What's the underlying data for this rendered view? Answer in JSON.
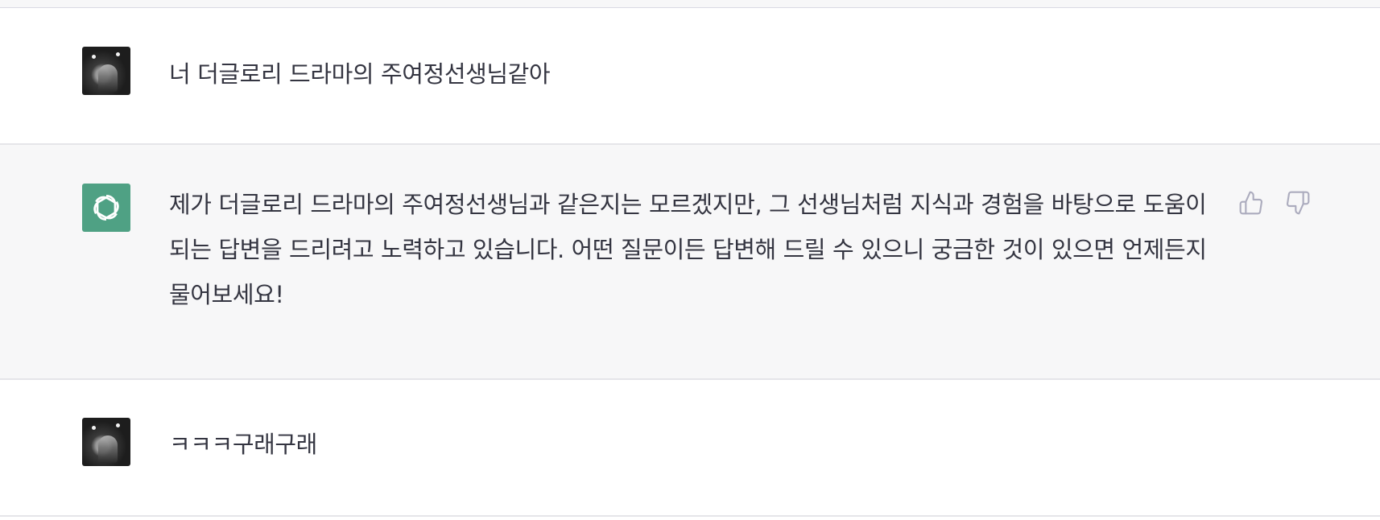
{
  "conversation": {
    "messages": [
      {
        "role": "user",
        "avatar": "user-photo-avatar",
        "text": "너 더글로리 드라마의 주여정선생님같아"
      },
      {
        "role": "assistant",
        "avatar": "openai-logo-icon",
        "text": "제가 더글로리 드라마의 주여정선생님과 같은지는 모르겠지만, 그 선생님처럼 지식과 경험을 바탕으로 도움이 되는 답변을 드리려고 노력하고 있습니다. 어떤 질문이든 답변해 드릴 수 있으니 궁금한 것이 있으면 언제든지 물어보세요!",
        "feedback": {
          "thumbs_up_icon": "thumbs-up-icon",
          "thumbs_down_icon": "thumbs-down-icon"
        }
      },
      {
        "role": "user",
        "avatar": "user-photo-avatar",
        "text": "ㅋㅋㅋ구래구래"
      }
    ]
  },
  "colors": {
    "assistant_bg": "#f7f7f8",
    "user_bg": "#ffffff",
    "bot_avatar": "#4fa184",
    "text": "#343541",
    "icon": "#acacbe"
  }
}
